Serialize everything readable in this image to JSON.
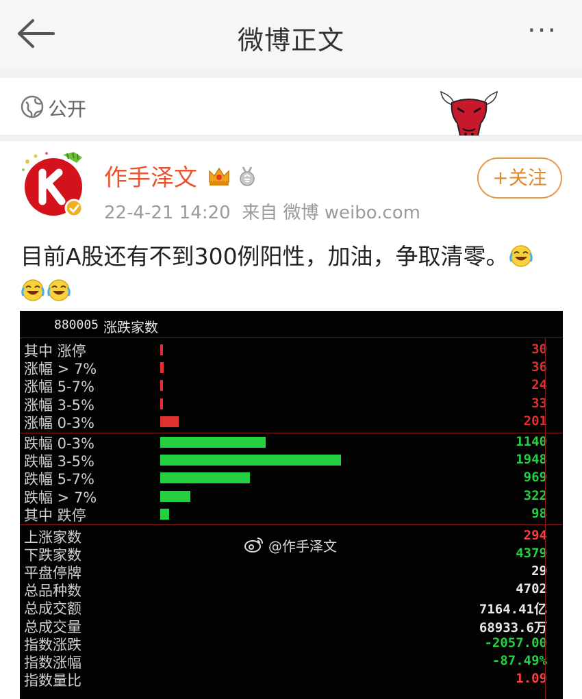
{
  "nav": {
    "title": "微博正文",
    "more": "···"
  },
  "visibility": {
    "label": "公开"
  },
  "post": {
    "username": "作手泽文",
    "time": "22-4-21 14:20",
    "source": "来自 微博 weibo.com",
    "follow_label": "+关注",
    "text": "目前A股还有不到300例阳性，加油，争取清零。"
  },
  "panel": {
    "code": "880005",
    "name": "涨跌家数",
    "dist_rows": [
      {
        "label": "其中 涨停",
        "value": "30",
        "count": 30,
        "color": "#e03030",
        "side": "up"
      },
      {
        "label": "涨幅 > 7%",
        "value": "36",
        "count": 36,
        "color": "#e03030",
        "side": "up"
      },
      {
        "label": "涨幅 5-7%",
        "value": "24",
        "count": 24,
        "color": "#e03030",
        "side": "up"
      },
      {
        "label": "涨幅 3-5%",
        "value": "33",
        "count": 33,
        "color": "#e03030",
        "side": "up"
      },
      {
        "label": "涨幅 0-3%",
        "value": "201",
        "count": 201,
        "color": "#e03030",
        "side": "up"
      },
      {
        "label": "跌幅 0-3%",
        "value": "1140",
        "count": 1140,
        "color": "#22d040",
        "side": "down"
      },
      {
        "label": "跌幅 3-5%",
        "value": "1948",
        "count": 1948,
        "color": "#22d040",
        "side": "down"
      },
      {
        "label": "跌幅 5-7%",
        "value": "969",
        "count": 969,
        "color": "#22d040",
        "side": "down"
      },
      {
        "label": "跌幅 > 7%",
        "value": "322",
        "count": 322,
        "color": "#22d040",
        "side": "down"
      },
      {
        "label": "其中 跌停",
        "value": "98",
        "count": 98,
        "color": "#22d040",
        "side": "down"
      }
    ],
    "stat_rows": [
      {
        "label": "上涨家数",
        "value": "294",
        "color": "#ff3b3b"
      },
      {
        "label": "下跌家数",
        "value": "4379",
        "color": "#22d040"
      },
      {
        "label": "平盘停牌",
        "value": "29",
        "color": "#e8e8e8"
      },
      {
        "label": "总品种数",
        "value": "4702",
        "color": "#e8e8e8"
      },
      {
        "label": "总成交额",
        "value": "7164.41亿",
        "color": "#e8e8e8"
      },
      {
        "label": "总成交量",
        "value": "68933.6万",
        "color": "#e8e8e8"
      },
      {
        "label": "指数涨跌",
        "value": "-2057.00",
        "color": "#22d040"
      },
      {
        "label": "指数涨幅",
        "value": "-87.49%",
        "color": "#22d040"
      },
      {
        "label": "指数量比",
        "value": "1.09",
        "color": "#ff3b3b"
      }
    ],
    "watermark": "@作手泽文",
    "colors": {
      "up": "#e03030",
      "down": "#22d040",
      "frame": "#8b1a1a"
    }
  }
}
